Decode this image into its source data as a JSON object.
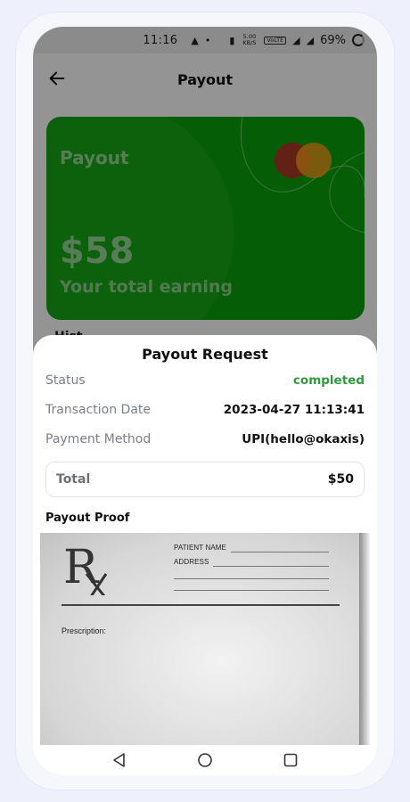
{
  "status_bar": {
    "time": "11:16",
    "net_speed": "5.00",
    "net_unit": "KB/S",
    "volte": "VoLTE",
    "battery": "69%"
  },
  "header": {
    "title": "Payout",
    "back_icon": "arrow-left-icon"
  },
  "card": {
    "label": "Payout",
    "amount": "$58",
    "subtitle": "Your total earning",
    "brand_icon": "mastercard-logo-icon",
    "background_color": "#0aa20a"
  },
  "history_peek": "Hist",
  "sheet": {
    "title": "Payout Request",
    "rows": [
      {
        "label": "Status",
        "value": "completed"
      },
      {
        "label": "Transaction Date",
        "value": "2023-04-27 11:13:41"
      },
      {
        "label": "Payment Method",
        "value": "UPI(hello@okaxis)"
      }
    ],
    "total": {
      "label": "Total",
      "value": "$50"
    },
    "proof_title": "Payout Proof",
    "proof": {
      "patient_label": "PATIENT NAME",
      "address_label": "ADDRESS",
      "prescription_label": "Prescription:"
    }
  },
  "colors": {
    "status_completed": "#2e9b3d",
    "overlay": "rgba(0,0,0,0.42)"
  },
  "nav": [
    "back-triangle-icon",
    "home-circle-icon",
    "recents-square-icon"
  ]
}
